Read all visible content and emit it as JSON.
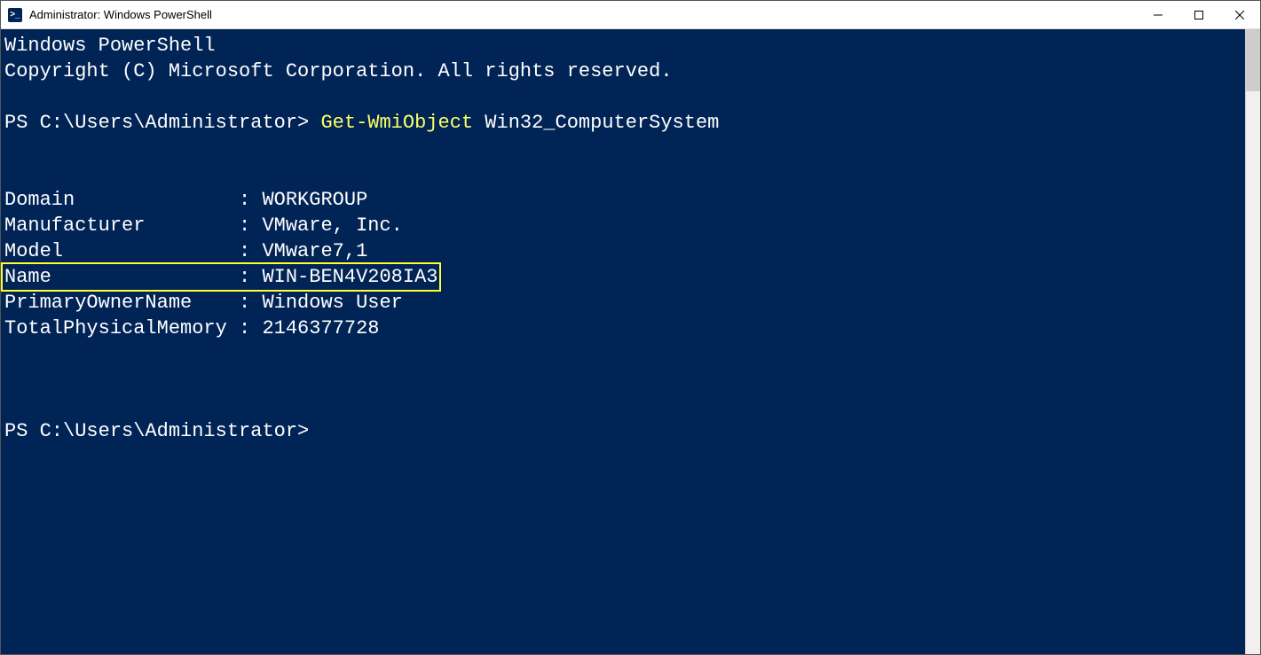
{
  "window": {
    "title": "Administrator: Windows PowerShell"
  },
  "terminal": {
    "banner_line1": "Windows PowerShell",
    "banner_line2": "Copyright (C) Microsoft Corporation. All rights reserved.",
    "prompt1_path": "PS C:\\Users\\Administrator> ",
    "cmdlet": "Get-WmiObject",
    "cmd_arg": " Win32_ComputerSystem",
    "output": [
      {
        "key": "Domain",
        "value": "WORKGROUP",
        "highlight": false
      },
      {
        "key": "Manufacturer",
        "value": "VMware, Inc.",
        "highlight": false
      },
      {
        "key": "Model",
        "value": "VMware7,1",
        "highlight": false
      },
      {
        "key": "Name",
        "value": "WIN-BEN4V208IA3",
        "highlight": true
      },
      {
        "key": "PrimaryOwnerName",
        "value": "Windows User",
        "highlight": false
      },
      {
        "key": "TotalPhysicalMemory",
        "value": "2146377728",
        "highlight": false
      }
    ],
    "prompt2_path": "PS C:\\Users\\Administrator>",
    "colon": " : "
  },
  "icons": {
    "ps_label": ">_"
  }
}
